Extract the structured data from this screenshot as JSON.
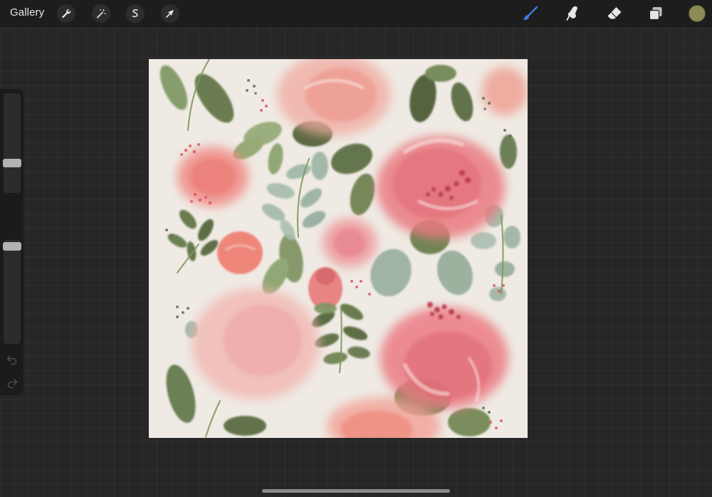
{
  "toolbar": {
    "gallery_label": "Gallery",
    "left_tools": [
      {
        "name": "actions",
        "icon": "wrench-icon"
      },
      {
        "name": "adjustments",
        "icon": "magic-wand-icon"
      },
      {
        "name": "selection",
        "icon": "selection-s-icon"
      },
      {
        "name": "transform",
        "icon": "cursor-arrow-icon"
      }
    ],
    "right_tools": [
      {
        "name": "brush",
        "icon": "paintbrush-icon",
        "active": true
      },
      {
        "name": "smudge",
        "icon": "smudge-finger-icon",
        "active": false
      },
      {
        "name": "eraser",
        "icon": "eraser-icon",
        "active": false
      },
      {
        "name": "layers",
        "icon": "layers-icon",
        "active": false
      }
    ],
    "current_color": "#8c8a55",
    "accent_color": "#3f7be0"
  },
  "sidebar": {
    "brush_size_level": 0.28,
    "brush_opacity_level": 0.98,
    "modify_icon": "square-outline-icon",
    "undo_icon": "undo-arrow-icon",
    "redo_icon": "redo-arrow-icon"
  },
  "canvas": {
    "artwork": "watercolor-floral-pattern",
    "background_color": "#efebe4"
  }
}
